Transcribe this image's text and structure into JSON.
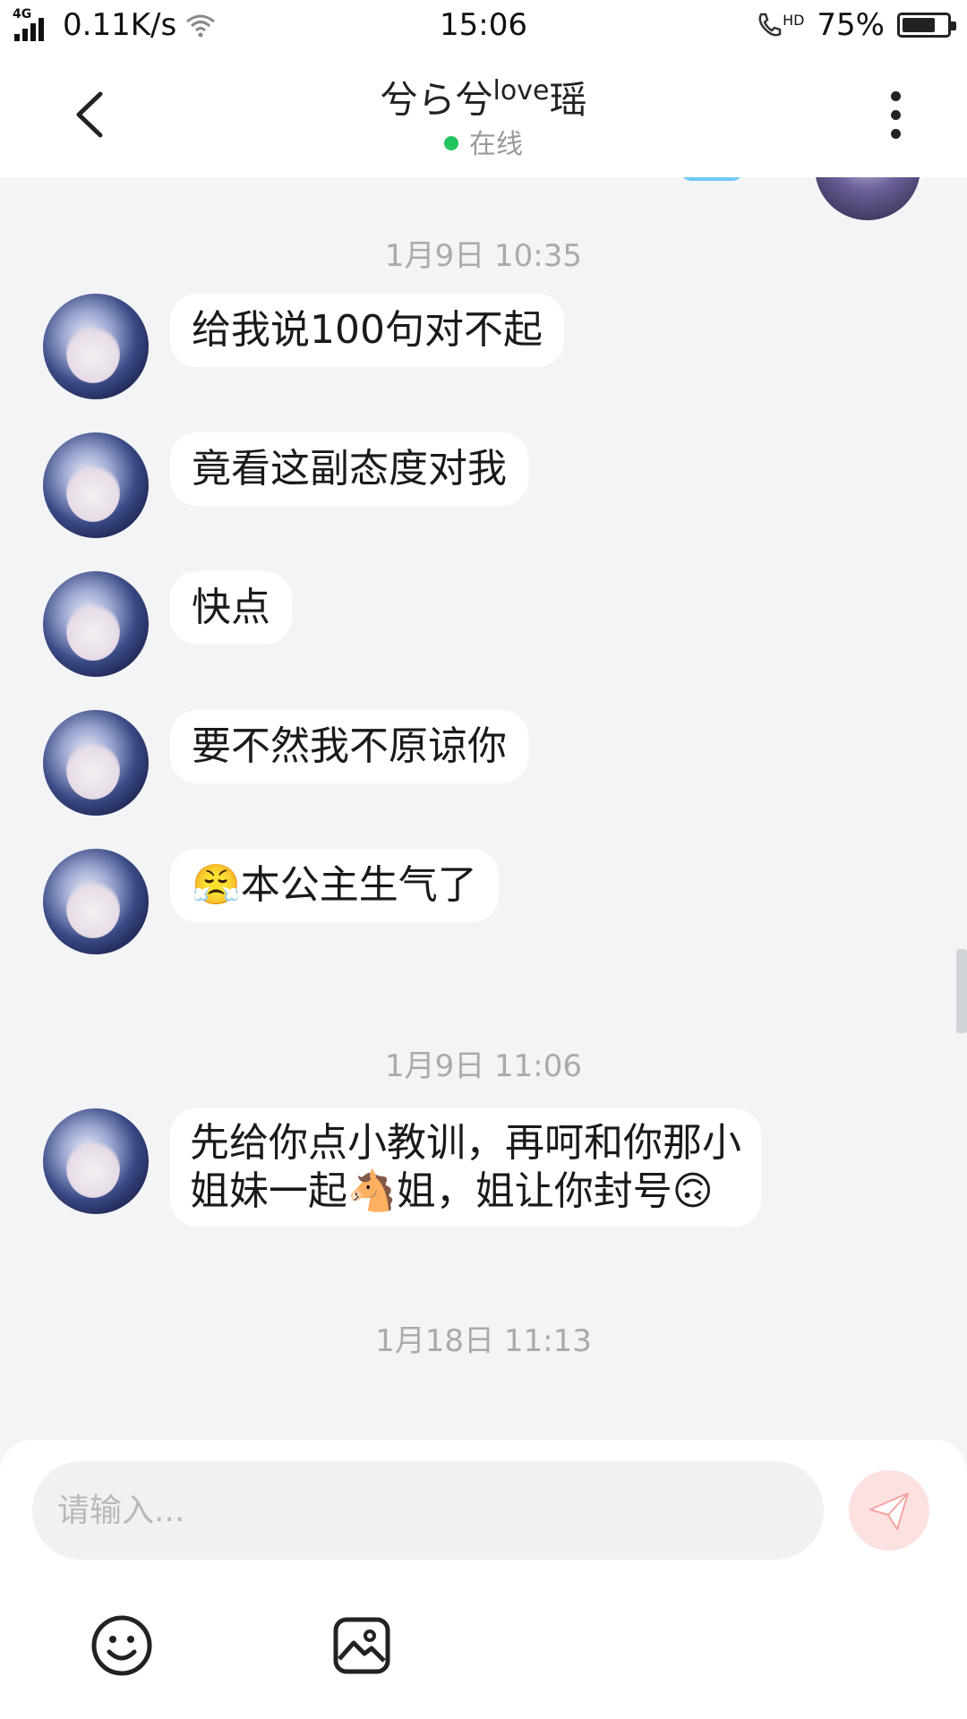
{
  "status_bar": {
    "network": "4G",
    "speed": "0.11K/s",
    "time": "15:06",
    "hd_label": "HD",
    "battery": "75%",
    "battery_level": 0.75
  },
  "header": {
    "title_main": "兮ら兮",
    "title_sup": "love",
    "title_end": "瑶",
    "presence": "在线",
    "presence_color": "#22c55e"
  },
  "chat": {
    "timestamps": [
      "1月9日 10:35",
      "1月9日 11:06",
      "1月18日 11:13"
    ],
    "messages": [
      {
        "text": "给我说100句对不起"
      },
      {
        "text": "竟看这副态度对我"
      },
      {
        "text": "快点"
      },
      {
        "text": "要不然我不原谅你"
      },
      {
        "emoji": "😤",
        "text": "本公主生气了"
      },
      {
        "line1": "先给你点小教训，再呵和你那小",
        "line2a": "姐妹一起",
        "emoji_mid": "🐴",
        "line2b": "姐，姐让你封号",
        "emoji_end": "🙃"
      }
    ]
  },
  "composer": {
    "placeholder": "请输入...",
    "send_icon": "paper-plane-icon",
    "tools": [
      "emoji-icon",
      "image-icon"
    ]
  }
}
